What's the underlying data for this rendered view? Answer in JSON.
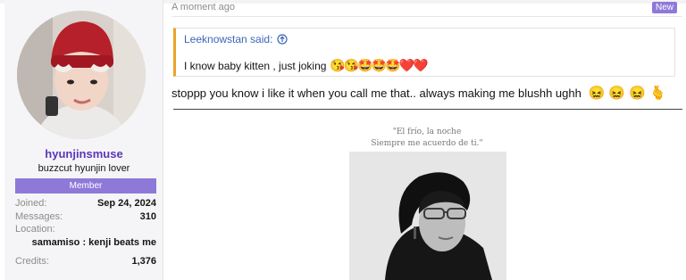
{
  "user": {
    "username": "hyunjinsmuse",
    "user_title": "buzzcut hyunjin lover",
    "banner": "Member",
    "stats": [
      {
        "label": "Joined:",
        "value": "Sep 24, 2024"
      },
      {
        "label": "Messages:",
        "value": "310"
      }
    ],
    "location_label": "Location:",
    "location_value": "samamiso : kenji beats me",
    "credits_label": "Credits:",
    "credits_value": "1,376"
  },
  "post": {
    "timestamp": "A moment ago",
    "new_badge": "New",
    "quote": {
      "author_line": "Leeknowstan said:",
      "text": "I know baby kitten , just joking",
      "emojis": "😘😘🤩🤩🤩❤️❤️"
    },
    "message": "stoppp you know i like it when you call me that.. always making me blushh ughh",
    "message_emojis": "😖 😖 😖 🫰",
    "poem_line1": "\"El frío, la noche",
    "poem_line2": "Siempre me acuerdo de ti.\""
  },
  "icons": {
    "quote_jump": "arrow-up-circle-icon"
  },
  "colors": {
    "accent": "#8e79d9",
    "username": "#5c36b8",
    "quote_border": "#e8a42c",
    "link": "#3a66b8"
  }
}
